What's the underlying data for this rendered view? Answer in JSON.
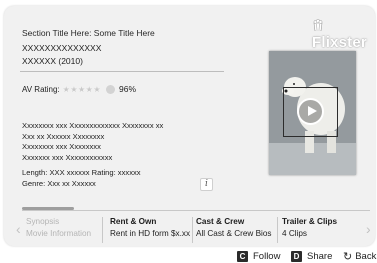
{
  "brand": {
    "logo_text": "Flixster"
  },
  "header": {
    "section_title": "Section Title Here: Some Title Here",
    "movie_title": "XXXXXXXXXXXXXX",
    "movie_subtitle": "XXXXXX (2010)"
  },
  "rating": {
    "label": "AV Rating:",
    "stars_text": "★★★★★",
    "stars_value": 4.5,
    "stars_max": 5,
    "score": "96%"
  },
  "cast_lines": [
    "Xxxxxxxx  xxx Xxxxxxxxxxxxx Xxxxxxxx xx",
    "Xxx xx Xxxxxx Xxxxxxxx",
    "Xxxxxxxx  xxx Xxxxxxxx",
    "Xxxxxxx  xxx Xxxxxxxxxxxx"
  ],
  "details": {
    "length_rating": "Length: XXX xxxxxx   Rating: xxxxxx",
    "genre": "Genre: Xxx xx Xxxxxx",
    "info_label": "i"
  },
  "tabs": [
    {
      "title": "Synopsis",
      "subtitle": "Movie Information",
      "state": "dimmed"
    },
    {
      "title": "Rent & Own",
      "subtitle": "Rent in HD form $x.xx",
      "state": "normal"
    },
    {
      "title": "Cast & Crew",
      "subtitle": "All Cast & Crew Bios",
      "state": "normal"
    },
    {
      "title": "Trailer & Clips",
      "subtitle": "4 Clips",
      "state": "normal"
    }
  ],
  "nav": {
    "prev_glyph": "‹",
    "next_glyph": "›"
  },
  "footer": {
    "follow": {
      "key": "C",
      "label": "Follow"
    },
    "share": {
      "key": "D",
      "label": "Share"
    },
    "back": {
      "glyph": "↻",
      "label": "Back"
    }
  },
  "colors": {
    "panel": "#f1f1f1",
    "accent": "#2b2b2b",
    "dimmed_text": "#b5b5b5"
  }
}
